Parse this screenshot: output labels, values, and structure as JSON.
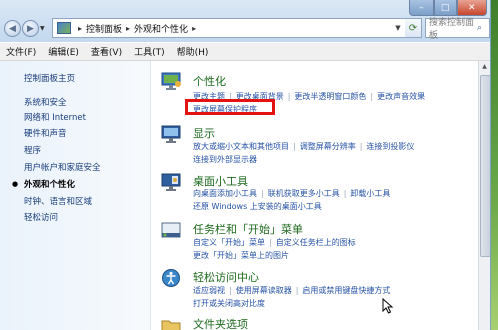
{
  "address": {
    "crumbs": [
      "控制面板",
      "外观和个性化"
    ],
    "search_placeholder": "搜索控制面板"
  },
  "menu": [
    "文件(F)",
    "编辑(E)",
    "查看(V)",
    "工具(T)",
    "帮助(H)"
  ],
  "sidebar": {
    "items": [
      {
        "label": "控制面板主页",
        "current": false
      },
      {
        "label": "系统和安全",
        "current": false
      },
      {
        "label": "网络和 Internet",
        "current": false
      },
      {
        "label": "硬件和声音",
        "current": false
      },
      {
        "label": "程序",
        "current": false
      },
      {
        "label": "用户帐户和家庭安全",
        "current": false
      },
      {
        "label": "外观和个性化",
        "current": true
      },
      {
        "label": "时钟、语言和区域",
        "current": false
      },
      {
        "label": "轻松访问",
        "current": false
      }
    ]
  },
  "categories": [
    {
      "title": "个性化",
      "rows": [
        [
          "更改主题",
          "更改桌面背景",
          "更改半透明窗口颜色",
          "更改声音效果"
        ],
        [
          "更改屏幕保护程序"
        ]
      ]
    },
    {
      "title": "显示",
      "rows": [
        [
          "放大或缩小文本和其他项目",
          "调整屏幕分辨率",
          "连接到投影仪"
        ],
        [
          "连接到外部显示器"
        ]
      ]
    },
    {
      "title": "桌面小工具",
      "rows": [
        [
          "向桌面添加小工具",
          "联机获取更多小工具",
          "卸载小工具"
        ],
        [
          "还原 Windows 上安装的桌面小工具"
        ]
      ]
    },
    {
      "title": "任务栏和「开始」菜单",
      "rows": [
        [
          "自定义「开始」菜单",
          "自定义任务栏上的图标"
        ],
        [
          "更改「开始」菜单上的图片"
        ]
      ]
    },
    {
      "title": "轻松访问中心",
      "rows": [
        [
          "适应弱视",
          "使用屏幕读取器",
          "启用或禁用键盘快捷方式"
        ],
        [
          "打开或关闭高对比度"
        ]
      ]
    },
    {
      "title": "文件夹选项",
      "rows": []
    }
  ]
}
